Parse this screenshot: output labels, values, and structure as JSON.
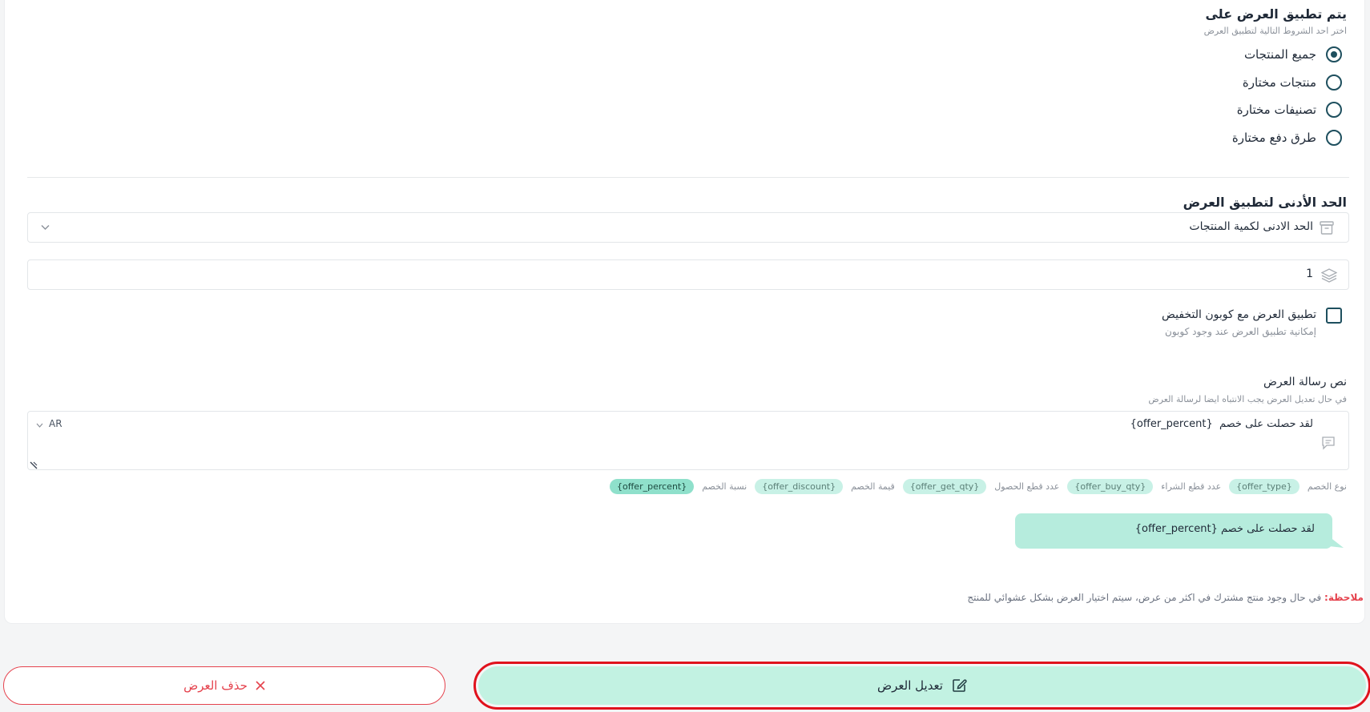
{
  "applies_on": {
    "title": "يتم تطبيق العرض على",
    "subtitle": "اختر احد الشروط التالية لتطبيق العرض",
    "options": [
      {
        "label": "جميع المنتجات",
        "selected": true
      },
      {
        "label": "منتجات مختارة",
        "selected": false
      },
      {
        "label": "تصنيفات مختارة",
        "selected": false
      },
      {
        "label": "طرق دفع مختارة",
        "selected": false
      }
    ]
  },
  "minimum": {
    "title": "الحد الأدنى لتطبيق العرض",
    "select_value": "الحد الادنى لكمية المنتجات",
    "quantity_value": "1"
  },
  "coupon": {
    "label": "تطبيق العرض مع كوبون التخفيض",
    "description": "إمكانية تطبيق العرض عند وجود كوبون",
    "checked": false
  },
  "message": {
    "title": "نص رسالة العرض",
    "subtitle": "في حال تعديل العرض يجب الانتباه ايضا لرسالة العرض",
    "text": "لقد حصلت على خصم  {offer_percent}",
    "lang": "AR"
  },
  "variables": [
    {
      "label": "نوع الخصم",
      "chip": "{offer_type}",
      "active": false
    },
    {
      "label": "عدد قطع الشراء",
      "chip": "{offer_buy_qty}",
      "active": false
    },
    {
      "label": "عدد قطع الحصول",
      "chip": "{offer_get_qty}",
      "active": false
    },
    {
      "label": "قيمة الخصم",
      "chip": "{offer_discount}",
      "active": false
    },
    {
      "label": "نسبة الخصم",
      "chip": "{offer_percent}",
      "active": true
    }
  ],
  "preview": {
    "text": "لقد حصلت على خصم {offer_percent}"
  },
  "note": {
    "label": "ملاحظة:",
    "text": "في حال وجود منتج مشترك في اكثر من عرض، سيتم اختيار العرض بشكل عشوائي للمنتج"
  },
  "actions": {
    "edit_label": "تعديل العرض",
    "delete_label": "حذف العرض"
  },
  "colors": {
    "accent": "#1e4f5e",
    "mint": "#c2f2e2",
    "danger": "#e5424d",
    "highlight": "#e0121d"
  }
}
